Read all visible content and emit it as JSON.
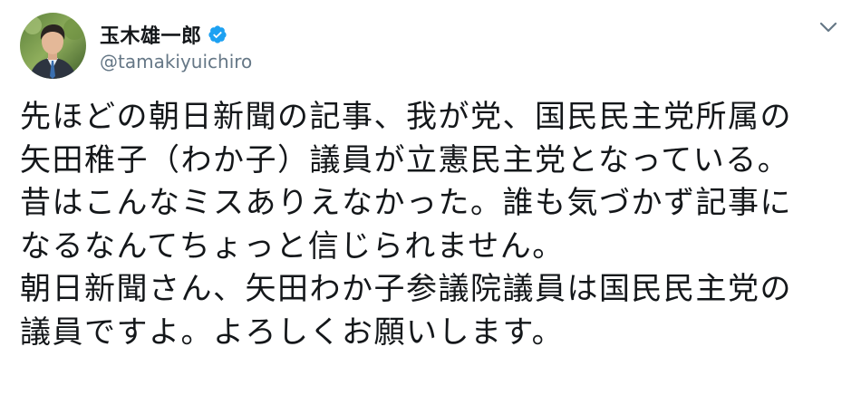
{
  "user": {
    "display_name": "玉木雄一郎",
    "handle": "@tamakiyuichiro"
  },
  "icons": {
    "avatar": "profile-photo",
    "verified": "verified-badge-icon",
    "caret": "chevron-down-icon"
  },
  "colors": {
    "verified_blue": "#1da1f2",
    "text": "#14171a",
    "secondary_text": "#657786"
  },
  "tweet": {
    "lines": [
      "先ほどの朝日新聞の記事、我が党、国民民主党所属の",
      "矢田稚子（わか子）議員が立憲民主党となっている。",
      "昔はこんなミスありえなかった。誰も気づかず記事に",
      "なるなんてちょっと信じられません。",
      "朝日新聞さん、矢田わか子参議院議員は国民民主党の",
      "議員ですよ。よろしくお願いします。"
    ]
  }
}
